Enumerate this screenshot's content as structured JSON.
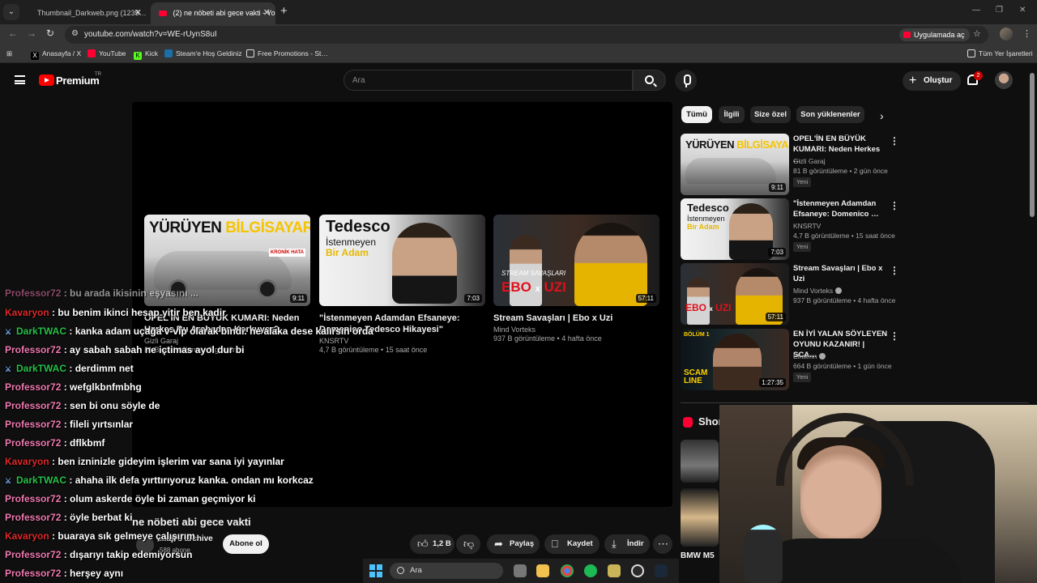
{
  "browser": {
    "tabs": [
      {
        "title": "Thumbnail_Darkweb.png (1235…"
      },
      {
        "title": "(2) ne nöbeti abi gece vakti - Yo…"
      }
    ],
    "url": "youtube.com/watch?v=WE-rUynS8uI",
    "open_in_app": "Uygulamada aç",
    "bookmarks": [
      "Anasayfa / X",
      "YouTube",
      "Kick",
      "Steam'e Hoş Geldiniz",
      "Free Promotions - St…"
    ],
    "all_bookmarks": "Tüm Yer İşaretleri"
  },
  "masthead": {
    "brand": "Premium",
    "region": "TR",
    "search_placeholder": "Ara",
    "create_label": "Oluştur",
    "notification_count": "2"
  },
  "player": {
    "end_cards": [
      {
        "title": "OPEL'İN EN BÜYÜK KUMARI: Neden Herkes Bu Arabadan Korkuyor?",
        "channel": "Gizli Garaj",
        "meta": "81 B görüntüleme • 2 gün önce",
        "duration": "9:11",
        "thumb_head": "YÜRÜYEN",
        "thumb_head_accent": "BİLGİSAYAR!",
        "thumb_tag": "KRONİK HATA"
      },
      {
        "title": "\"İstenmeyen Adamdan Efsaneye: Domenico Tedesco Hikayesi\"",
        "channel": "KNSRTV",
        "meta": "4,7 B görüntüleme • 15 saat önce",
        "duration": "7:03",
        "thumb_line1": "Tedesco",
        "thumb_line2": "İstenmeyen",
        "thumb_line3": "Bir Adam"
      },
      {
        "title": "Stream Savaşları | Ebo x Uzi",
        "channel": "Mind Vorteks",
        "meta": "937 B görüntüleme • 4 hafta önce",
        "duration": "57:11",
        "thumb_label": "STREAM SAVAŞLARI",
        "thumb_ebo": "EBO",
        "thumb_x": "x",
        "thumb_uzi": "UZI"
      }
    ]
  },
  "video": {
    "title": "ne nöbeti abi gece vakti",
    "channel": "...ap's archive",
    "subs": "588 abone",
    "subscribe_label": "Abone ol",
    "likes": "1,2 B",
    "share_label": "Paylaş",
    "save_label": "Kaydet",
    "download_label": "İndir"
  },
  "sidebar": {
    "chips": [
      "Tümü",
      "İlgili",
      "Size özel",
      "Son yüklenenler"
    ],
    "recommendations": [
      {
        "title": "OPEL'İN EN BÜYÜK KUMARI: Neden Herkes …",
        "channel": "Gizli Garaj",
        "meta": "81 B görüntüleme • 2 gün önce",
        "badge": "Yeni",
        "duration": "9:11"
      },
      {
        "title": "\"İstenmeyen Adamdan Efsaneye: Domenico …",
        "channel": "KNSRTV",
        "meta": "4,7 B görüntüleme • 15 saat önce",
        "badge": "Yeni",
        "duration": "7:03"
      },
      {
        "title": "Stream Savaşları | Ebo x Uzi",
        "channel": "Mind Vorteks",
        "meta": "937 B görüntüleme • 4 hafta önce",
        "badge": "",
        "duration": "57:11"
      },
      {
        "title": "EN İYİ YALAN SÖYLEYEN OYUNU KAZANIR! | SCA…",
        "channel": "Elraenn",
        "meta": "664 B görüntüleme • 1 gün önce",
        "badge": "Yeni",
        "duration": "1:27:35",
        "thumb_top": "BÖLÜM 1",
        "thumb_bottom": "SCAM LINE"
      }
    ],
    "shorts_label": "Shorts",
    "short_caption": "BMW M5"
  },
  "chat": [
    {
      "user": "Professor72",
      "message": ": bu arada ikisinin eşyasını ...",
      "color": "pink",
      "mod": false
    },
    {
      "user": "Kavaryon",
      "message": ": bu benim ikinci hesap yitir ben kadir",
      "color": "red",
      "mod": false
    },
    {
      "user": "DarkTWAC",
      "message": ": kanka adam uçağa v-vip olarak bindi. ne alaka dese kalırsın orda",
      "color": "green",
      "mod": true
    },
    {
      "user": "Professor72",
      "message": ": ay sabah sabah ne içtimas ayol dur bi",
      "color": "pink",
      "mod": false
    },
    {
      "user": "DarkTWAC",
      "message": ": derdimm net",
      "color": "green",
      "mod": true
    },
    {
      "user": "Professor72",
      "message": ": wefglkbnfmbhg",
      "color": "pink",
      "mod": false
    },
    {
      "user": "Professor72",
      "message": ": sen bi onu söyle de",
      "color": "pink",
      "mod": false
    },
    {
      "user": "Professor72",
      "message": ": fileli yırtsınlar",
      "color": "pink",
      "mod": false
    },
    {
      "user": "Professor72",
      "message": ": dflkbmf",
      "color": "pink",
      "mod": false
    },
    {
      "user": "Kavaryon",
      "message": ": ben izninizle gideyim işlerim var sana iyi yayınlar",
      "color": "red",
      "mod": false
    },
    {
      "user": "DarkTWAC",
      "message": ": ahaha ilk defa yırttırıyoruz kanka. ondan mı korkcaz",
      "color": "green",
      "mod": true
    },
    {
      "user": "Professor72",
      "message": ": olum askerde öyle bi zaman geçmiyor ki",
      "color": "pink",
      "mod": false
    },
    {
      "user": "Professor72",
      "message": ": öyle berbat ki",
      "color": "pink",
      "mod": false
    },
    {
      "user": "Kavaryon",
      "message": ": buaraya sık gelmeye çalışırım",
      "color": "red",
      "mod": false
    },
    {
      "user": "Professor72",
      "message": ": dışarıyı takip edemiyorsun",
      "color": "pink",
      "mod": false
    },
    {
      "user": "Professor72",
      "message": ": herşey aynı",
      "color": "pink",
      "mod": false
    }
  ],
  "taskbar": {
    "search_label": "Ara"
  },
  "colors": {
    "accent_red": "#ff0000",
    "chat_pink": "#f07ab1",
    "chat_red": "#e02a2a",
    "chat_green": "#27c24a"
  }
}
